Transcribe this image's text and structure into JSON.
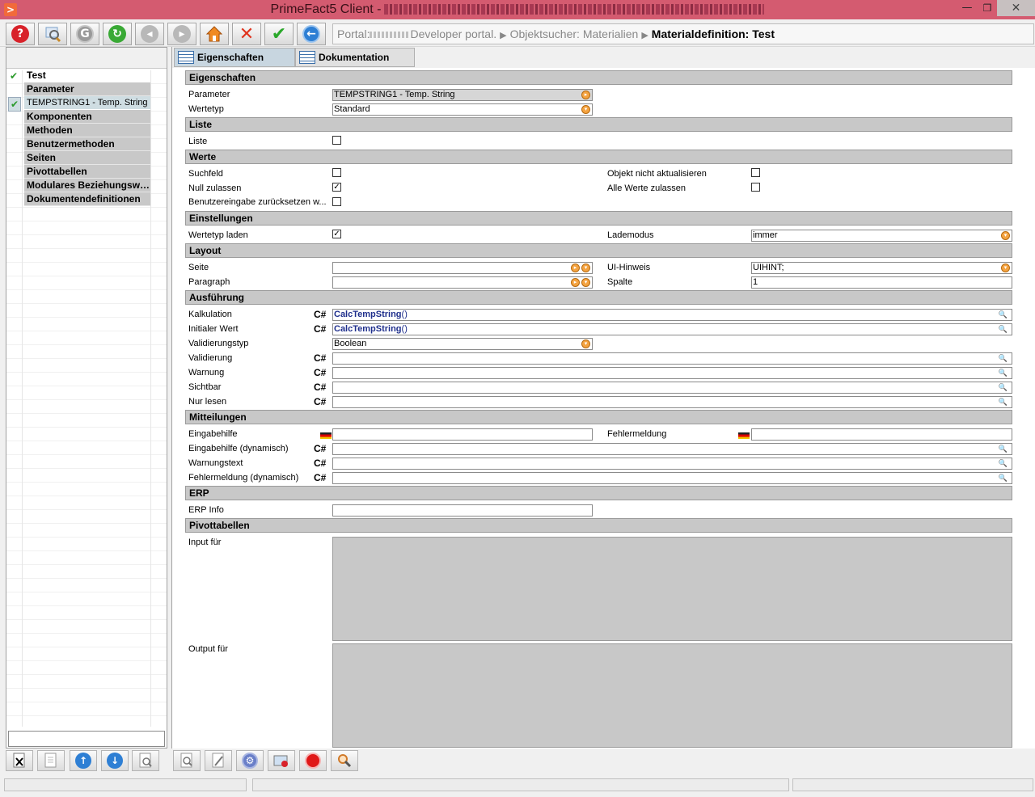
{
  "window": {
    "title": "PrimeFact5 Client -",
    "min_glyph": "—",
    "max_glyph": "❐",
    "close_glyph": "✕"
  },
  "toolbar": {
    "buttons": [
      {
        "icon": "help-icon"
      },
      {
        "icon": "search-icon"
      },
      {
        "icon": "back-disabled-icon"
      },
      {
        "icon": "refresh-icon"
      },
      {
        "icon": "prev-disabled-icon"
      },
      {
        "icon": "next-disabled-icon"
      },
      {
        "icon": "home-icon"
      },
      {
        "icon": "cancel-icon"
      },
      {
        "icon": "confirm-icon"
      },
      {
        "icon": "navigate-back-icon"
      }
    ]
  },
  "breadcrumb": {
    "portal_prefix": "Portal:",
    "portal_name": "Developer portal.",
    "crumb2": "Objektsucher: Materialien",
    "current": "Materialdefinition: Test"
  },
  "tree": {
    "root": "Test",
    "items": [
      {
        "label": "Parameter"
      },
      {
        "label": "TEMPSTRING1 - Temp. String"
      },
      {
        "label": "Komponenten"
      },
      {
        "label": "Methoden"
      },
      {
        "label": "Benutzermethoden"
      },
      {
        "label": "Seiten"
      },
      {
        "label": "Pivottabellen"
      },
      {
        "label": "Modulares Beziehungswi..."
      },
      {
        "label": "Dokumentendefinitionen"
      }
    ],
    "search_value": ""
  },
  "tabs": [
    {
      "label": "Eigenschaften"
    },
    {
      "label": "Dokumentation"
    }
  ],
  "form": {
    "sections": {
      "eigenschaften": "Eigenschaften",
      "liste": "Liste",
      "werte": "Werte",
      "einstellungen": "Einstellungen",
      "layout": "Layout",
      "ausfuehrung": "Ausführung",
      "mitteilungen": "Mitteilungen",
      "erp": "ERP",
      "pivottabellen": "Pivottabellen"
    },
    "parameter": {
      "label": "Parameter",
      "value": "TEMPSTRING1 - Temp. String"
    },
    "wertetyp": {
      "label": "Wertetyp",
      "value": "Standard"
    },
    "liste": {
      "label": "Liste"
    },
    "suchfeld": {
      "label": "Suchfeld"
    },
    "null_zulassen": {
      "label": "Null zulassen"
    },
    "benutzereingabe": {
      "label": "Benutzereingabe zurücksetzen w..."
    },
    "objekt_nicht_aktualisieren": {
      "label": "Objekt nicht aktualisieren"
    },
    "alle_werte_zulassen": {
      "label": "Alle Werte zulassen"
    },
    "wertetyp_laden": {
      "label": "Wertetyp laden"
    },
    "lademodus": {
      "label": "Lademodus",
      "value": "immer"
    },
    "seite": {
      "label": "Seite",
      "value": ""
    },
    "paragraph": {
      "label": "Paragraph",
      "value": ""
    },
    "ui_hinweis": {
      "label": "UI-Hinweis",
      "value": "UIHINT;"
    },
    "spalte": {
      "label": "Spalte",
      "value": "1"
    },
    "cs_tag": "C#",
    "kalkulation": {
      "label": "Kalkulation",
      "code": "CalcTempString",
      "paren": "()"
    },
    "initialer_wert": {
      "label": "Initialer Wert",
      "code": "CalcTempString",
      "paren": "()"
    },
    "validierungstyp": {
      "label": "Validierungstyp",
      "value": "Boolean"
    },
    "validierung": {
      "label": "Validierung",
      "value": ""
    },
    "warnung": {
      "label": "Warnung",
      "value": ""
    },
    "sichtbar": {
      "label": "Sichtbar",
      "value": ""
    },
    "nur_lesen": {
      "label": "Nur lesen",
      "value": ""
    },
    "eingabehilfe": {
      "label": "Eingabehilfe",
      "value": ""
    },
    "fehlermeldung": {
      "label": "Fehlermeldung",
      "value": ""
    },
    "eingabehilfe_dyn": {
      "label": "Eingabehilfe (dynamisch)",
      "value": ""
    },
    "warnungstext": {
      "label": "Warnungstext",
      "value": ""
    },
    "fehlermeldung_dyn": {
      "label": "Fehlermeldung (dynamisch)",
      "value": ""
    },
    "erp_info": {
      "label": "ERP Info",
      "value": ""
    },
    "input_fuer": {
      "label": "Input für"
    },
    "output_fuer": {
      "label": "Output für"
    }
  },
  "colors": {
    "title_bar": "#d45b70",
    "section_bg": "#c8c8c8",
    "dropdown_orange": "#f4a340",
    "code_blue": "#1f2f8c",
    "check_green": "#2a9a2a"
  }
}
